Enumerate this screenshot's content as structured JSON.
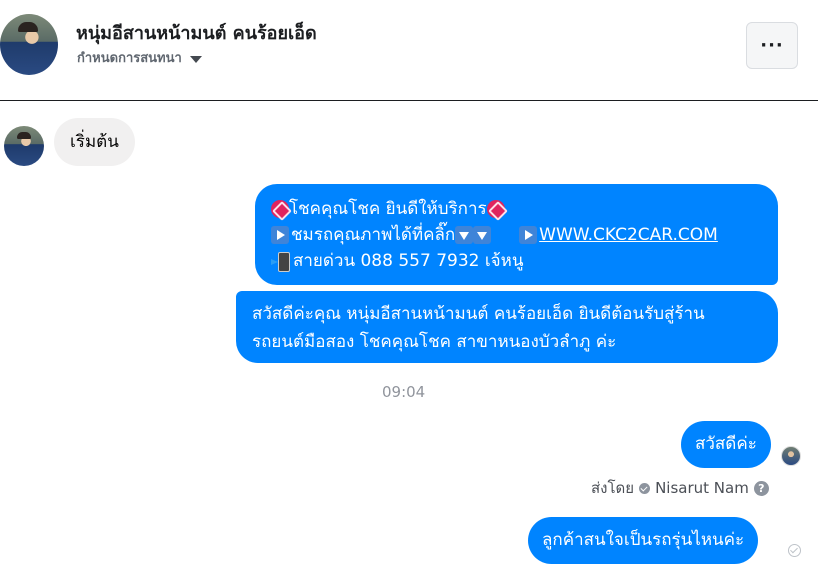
{
  "header": {
    "title": "หนุ่มอีสานหน้ามนต์ คนร้อยเอ็ด",
    "subtitle": "กำหนดการสนทนา",
    "more_label": "···"
  },
  "messages": {
    "incoming_1": "เริ่มต้น",
    "outgoing_1": {
      "line1": "โชคคุณโชค ยินดีให้บริการ",
      "line2_text": "ชมรถคุณภาพได้ที่คลิ๊ก",
      "line2_link": "WWW.CKC2CAR.COM",
      "line3": "สายด่วน 088 557 7932 เจ้หนู"
    },
    "outgoing_2": {
      "line1": "สวัสดีค่ะคุณ หนุ่มอีสานหน้ามนต์ คนร้อยเอ็ด ยินดีต้อนรับสู่ร้าน",
      "line2": "รถยนต์มือสอง โชคคุณโชค สาขาหนองบัวลำภู ค่ะ"
    },
    "timestamp": "09:04",
    "outgoing_3": "สวัสดีค่ะ",
    "sent_by_label": "ส่งโดย",
    "sent_by_name": "Nisarut Nam",
    "help_glyph": "?",
    "outgoing_4": "ลูกค้าสนใจเป็นรถรุ่นไหนค่ะ"
  },
  "icons": {
    "anger": "anger-symbol-icon",
    "play": "play-button-icon",
    "down": "down-arrow-icon",
    "phone": "mobile-phone-arrow-icon"
  },
  "colors": {
    "outgoing_bubble": "#0084ff",
    "incoming_bubble": "#f1f0f0"
  }
}
